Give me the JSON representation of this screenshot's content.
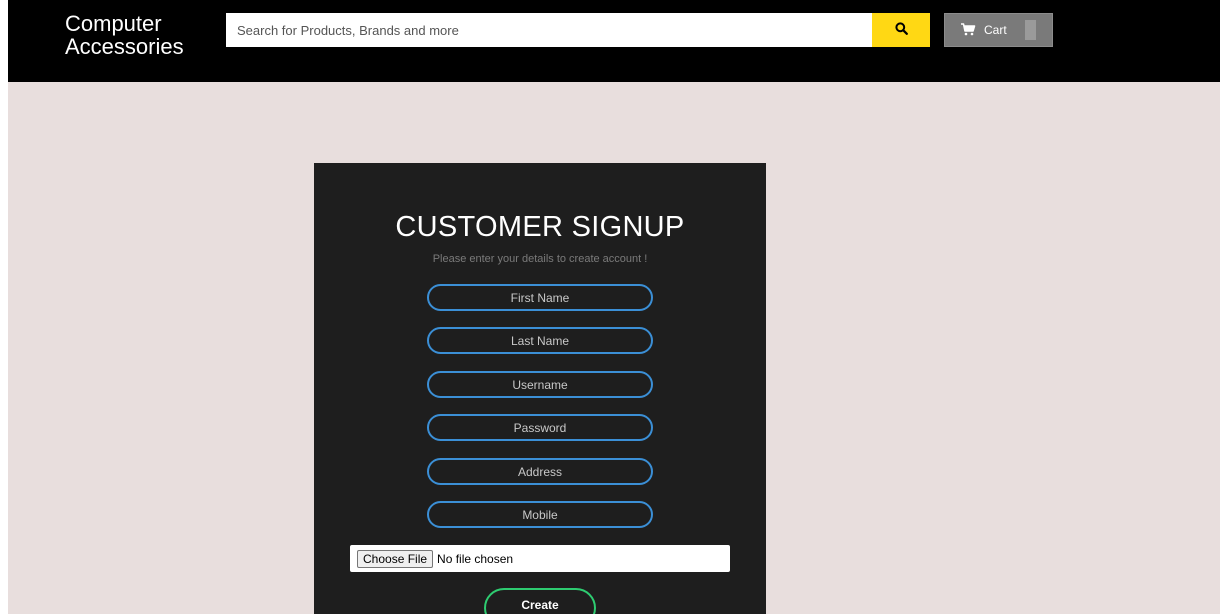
{
  "header": {
    "brand_line1": "Computer",
    "brand_line2": "Accessories",
    "search_placeholder": "Search for Products, Brands and more",
    "cart_label": "Cart"
  },
  "signup": {
    "title": "CUSTOMER SIGNUP",
    "subtitle": "Please enter your details to create account !",
    "fields": {
      "first_name": "First Name",
      "last_name": "Last Name",
      "username": "Username",
      "password": "Password",
      "address": "Address",
      "mobile": "Mobile"
    },
    "file_button": "Choose File",
    "file_status": "No file chosen",
    "submit_label": "Create"
  },
  "colors": {
    "header_bg": "#000000",
    "search_button": "#ffd814",
    "cart_button": "#7a7a7a",
    "page_bg": "#e8dedd",
    "panel_bg": "#1e1e1e",
    "field_border": "#3b8fd6",
    "submit_border": "#2ecc71"
  },
  "icons": {
    "search": "search-icon",
    "cart": "cart-icon"
  }
}
